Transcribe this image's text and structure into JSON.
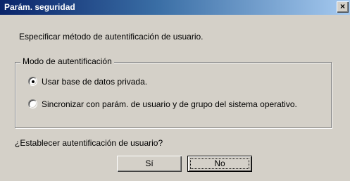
{
  "window": {
    "title": "Parám. seguridad",
    "close_glyph": "×",
    "close_icon": "close-icon"
  },
  "main": {
    "description": "Especificar método de autentificación de usuario.",
    "auth_group": {
      "label": "Modo de autentificación",
      "options": [
        {
          "label": "Usar base de datos privada.",
          "selected": true
        },
        {
          "label": "Sincronizar con parám. de usuario y de grupo del sistema operativo.",
          "selected": false
        }
      ]
    },
    "question": "¿Establecer autentificación de usuario?"
  },
  "buttons": {
    "yes_label": "Sí",
    "no_label": "No"
  }
}
